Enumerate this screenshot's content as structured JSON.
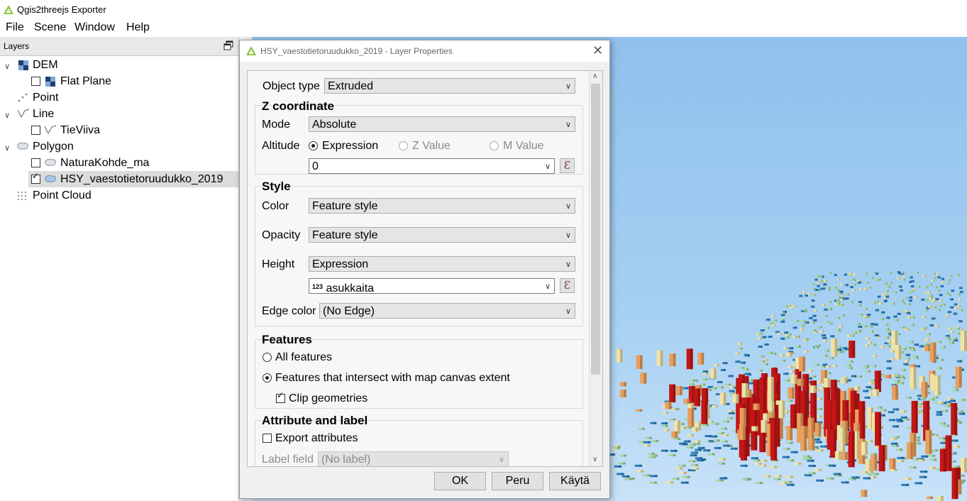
{
  "app": {
    "title": "Qgis2threejs Exporter"
  },
  "menu": [
    "File",
    "Scene",
    "Window",
    "Help"
  ],
  "layers_panel": {
    "title": "Layers",
    "items": [
      {
        "label": "DEM",
        "checked": null
      },
      {
        "label": "Flat Plane",
        "checked": false
      },
      {
        "label": "Point",
        "checked": null
      },
      {
        "label": "Line",
        "checked": null
      },
      {
        "label": "TieViiva",
        "checked": false
      },
      {
        "label": "Polygon",
        "checked": null
      },
      {
        "label": "NaturaKohde_ma",
        "checked": false
      },
      {
        "label": "HSY_vaestotietoruudukko_2019",
        "checked": true
      },
      {
        "label": "Point Cloud",
        "checked": null
      }
    ]
  },
  "dialog": {
    "title": "HSY_vaestotietoruudukko_2019 - Layer Properties",
    "object_type_label": "Object type",
    "object_type": "Extruded",
    "z_coordinate": {
      "header": "Z coordinate",
      "mode_label": "Mode",
      "mode": "Absolute",
      "altitude_label": "Altitude",
      "options": [
        "Expression",
        "Z Value",
        "M Value"
      ],
      "selected": "Expression",
      "expression": "0"
    },
    "style": {
      "header": "Style",
      "color_label": "Color",
      "color": "Feature style",
      "opacity_label": "Opacity",
      "opacity": "Feature style",
      "height_label": "Height",
      "height": "Expression",
      "height_field_prefix": "123",
      "height_field": "asukkaita",
      "edge_color_label": "Edge color",
      "edge_color": "(No Edge)"
    },
    "features": {
      "header": "Features",
      "all": "All features",
      "intersect": "Features that intersect with map canvas extent",
      "selected": "intersect",
      "clip": "Clip geometries",
      "clip_checked": true
    },
    "attribute": {
      "header": "Attribute and label",
      "export": "Export attributes",
      "export_checked": false,
      "label_field_label": "Label field",
      "label_field": "(No label)"
    },
    "buttons": {
      "ok": "OK",
      "cancel": "Peru",
      "apply": "Käytä"
    }
  },
  "colors": {
    "sky_top": "#8fc1ec",
    "sky_bottom": "#c8e2f8",
    "bar_red": "#c41616",
    "bar_orange": "#e9a05e",
    "bar_cream": "#efe3a6",
    "bar_green": "#a6d6a2",
    "bar_blue": "#2b7bb9"
  }
}
